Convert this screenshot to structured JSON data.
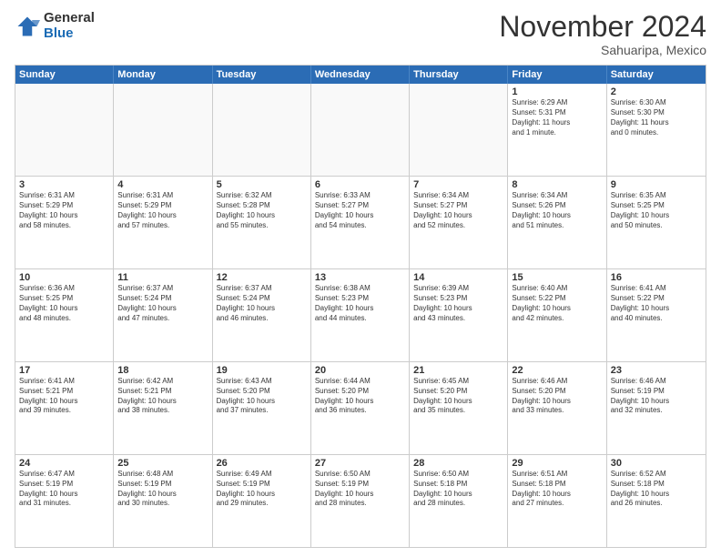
{
  "header": {
    "logo_general": "General",
    "logo_blue": "Blue",
    "month_title": "November 2024",
    "location": "Sahuaripa, Mexico"
  },
  "days_of_week": [
    "Sunday",
    "Monday",
    "Tuesday",
    "Wednesday",
    "Thursday",
    "Friday",
    "Saturday"
  ],
  "weeks": [
    [
      {
        "day": "",
        "text": ""
      },
      {
        "day": "",
        "text": ""
      },
      {
        "day": "",
        "text": ""
      },
      {
        "day": "",
        "text": ""
      },
      {
        "day": "",
        "text": ""
      },
      {
        "day": "1",
        "text": "Sunrise: 6:29 AM\nSunset: 5:31 PM\nDaylight: 11 hours\nand 1 minute."
      },
      {
        "day": "2",
        "text": "Sunrise: 6:30 AM\nSunset: 5:30 PM\nDaylight: 11 hours\nand 0 minutes."
      }
    ],
    [
      {
        "day": "3",
        "text": "Sunrise: 6:31 AM\nSunset: 5:29 PM\nDaylight: 10 hours\nand 58 minutes."
      },
      {
        "day": "4",
        "text": "Sunrise: 6:31 AM\nSunset: 5:29 PM\nDaylight: 10 hours\nand 57 minutes."
      },
      {
        "day": "5",
        "text": "Sunrise: 6:32 AM\nSunset: 5:28 PM\nDaylight: 10 hours\nand 55 minutes."
      },
      {
        "day": "6",
        "text": "Sunrise: 6:33 AM\nSunset: 5:27 PM\nDaylight: 10 hours\nand 54 minutes."
      },
      {
        "day": "7",
        "text": "Sunrise: 6:34 AM\nSunset: 5:27 PM\nDaylight: 10 hours\nand 52 minutes."
      },
      {
        "day": "8",
        "text": "Sunrise: 6:34 AM\nSunset: 5:26 PM\nDaylight: 10 hours\nand 51 minutes."
      },
      {
        "day": "9",
        "text": "Sunrise: 6:35 AM\nSunset: 5:25 PM\nDaylight: 10 hours\nand 50 minutes."
      }
    ],
    [
      {
        "day": "10",
        "text": "Sunrise: 6:36 AM\nSunset: 5:25 PM\nDaylight: 10 hours\nand 48 minutes."
      },
      {
        "day": "11",
        "text": "Sunrise: 6:37 AM\nSunset: 5:24 PM\nDaylight: 10 hours\nand 47 minutes."
      },
      {
        "day": "12",
        "text": "Sunrise: 6:37 AM\nSunset: 5:24 PM\nDaylight: 10 hours\nand 46 minutes."
      },
      {
        "day": "13",
        "text": "Sunrise: 6:38 AM\nSunset: 5:23 PM\nDaylight: 10 hours\nand 44 minutes."
      },
      {
        "day": "14",
        "text": "Sunrise: 6:39 AM\nSunset: 5:23 PM\nDaylight: 10 hours\nand 43 minutes."
      },
      {
        "day": "15",
        "text": "Sunrise: 6:40 AM\nSunset: 5:22 PM\nDaylight: 10 hours\nand 42 minutes."
      },
      {
        "day": "16",
        "text": "Sunrise: 6:41 AM\nSunset: 5:22 PM\nDaylight: 10 hours\nand 40 minutes."
      }
    ],
    [
      {
        "day": "17",
        "text": "Sunrise: 6:41 AM\nSunset: 5:21 PM\nDaylight: 10 hours\nand 39 minutes."
      },
      {
        "day": "18",
        "text": "Sunrise: 6:42 AM\nSunset: 5:21 PM\nDaylight: 10 hours\nand 38 minutes."
      },
      {
        "day": "19",
        "text": "Sunrise: 6:43 AM\nSunset: 5:20 PM\nDaylight: 10 hours\nand 37 minutes."
      },
      {
        "day": "20",
        "text": "Sunrise: 6:44 AM\nSunset: 5:20 PM\nDaylight: 10 hours\nand 36 minutes."
      },
      {
        "day": "21",
        "text": "Sunrise: 6:45 AM\nSunset: 5:20 PM\nDaylight: 10 hours\nand 35 minutes."
      },
      {
        "day": "22",
        "text": "Sunrise: 6:46 AM\nSunset: 5:20 PM\nDaylight: 10 hours\nand 33 minutes."
      },
      {
        "day": "23",
        "text": "Sunrise: 6:46 AM\nSunset: 5:19 PM\nDaylight: 10 hours\nand 32 minutes."
      }
    ],
    [
      {
        "day": "24",
        "text": "Sunrise: 6:47 AM\nSunset: 5:19 PM\nDaylight: 10 hours\nand 31 minutes."
      },
      {
        "day": "25",
        "text": "Sunrise: 6:48 AM\nSunset: 5:19 PM\nDaylight: 10 hours\nand 30 minutes."
      },
      {
        "day": "26",
        "text": "Sunrise: 6:49 AM\nSunset: 5:19 PM\nDaylight: 10 hours\nand 29 minutes."
      },
      {
        "day": "27",
        "text": "Sunrise: 6:50 AM\nSunset: 5:19 PM\nDaylight: 10 hours\nand 28 minutes."
      },
      {
        "day": "28",
        "text": "Sunrise: 6:50 AM\nSunset: 5:18 PM\nDaylight: 10 hours\nand 28 minutes."
      },
      {
        "day": "29",
        "text": "Sunrise: 6:51 AM\nSunset: 5:18 PM\nDaylight: 10 hours\nand 27 minutes."
      },
      {
        "day": "30",
        "text": "Sunrise: 6:52 AM\nSunset: 5:18 PM\nDaylight: 10 hours\nand 26 minutes."
      }
    ]
  ]
}
